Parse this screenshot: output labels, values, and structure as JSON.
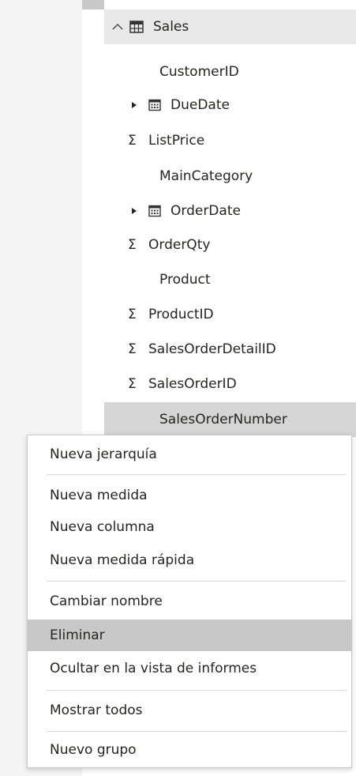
{
  "table": {
    "name": "Sales",
    "collapse_icon": "chevron-up-icon",
    "table_icon": "table-grid-icon"
  },
  "fields": [
    {
      "label": "CustomerID",
      "marker": "",
      "kind": "text"
    },
    {
      "label": "DueDate",
      "marker": "",
      "kind": "date-hierarchy"
    },
    {
      "label": "ListPrice",
      "marker": "Σ",
      "kind": "numeric"
    },
    {
      "label": "MainCategory",
      "marker": "",
      "kind": "text"
    },
    {
      "label": "OrderDate",
      "marker": "",
      "kind": "date-hierarchy"
    },
    {
      "label": "OrderQty",
      "marker": "Σ",
      "kind": "numeric"
    },
    {
      "label": "Product",
      "marker": "",
      "kind": "text"
    },
    {
      "label": "ProductID",
      "marker": "Σ",
      "kind": "numeric"
    },
    {
      "label": "SalesOrderDetailID",
      "marker": "Σ",
      "kind": "numeric"
    },
    {
      "label": "SalesOrderID",
      "marker": "Σ",
      "kind": "numeric"
    },
    {
      "label": "SalesOrderNumber",
      "marker": "",
      "kind": "text",
      "selected": true
    }
  ],
  "context_menu": {
    "items": [
      {
        "label": "Nueva jerarquía"
      },
      {
        "label": "Nueva medida"
      },
      {
        "label": "Nueva columna"
      },
      {
        "label": "Nueva medida rápida"
      },
      {
        "label": "Cambiar nombre"
      },
      {
        "label": "Eliminar",
        "highlighted": true
      },
      {
        "label": "Ocultar en la vista de informes"
      },
      {
        "label": "Mostrar todos"
      },
      {
        "label": "Nuevo grupo"
      }
    ]
  },
  "colors": {
    "selected_row": "#d5d5d5",
    "menu_highlight": "#c8c8c8",
    "header_bg": "#e8e8e8",
    "text": "#252423"
  }
}
